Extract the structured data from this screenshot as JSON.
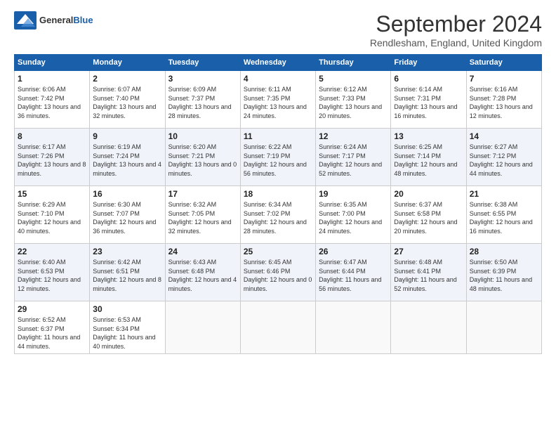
{
  "header": {
    "logo_general": "General",
    "logo_blue": "Blue",
    "title": "September 2024",
    "location": "Rendlesham, England, United Kingdom"
  },
  "weekdays": [
    "Sunday",
    "Monday",
    "Tuesday",
    "Wednesday",
    "Thursday",
    "Friday",
    "Saturday"
  ],
  "weeks": [
    [
      {
        "day": "1",
        "sunrise": "6:06 AM",
        "sunset": "7:42 PM",
        "daylight": "13 hours and 36 minutes."
      },
      {
        "day": "2",
        "sunrise": "6:07 AM",
        "sunset": "7:40 PM",
        "daylight": "13 hours and 32 minutes."
      },
      {
        "day": "3",
        "sunrise": "6:09 AM",
        "sunset": "7:37 PM",
        "daylight": "13 hours and 28 minutes."
      },
      {
        "day": "4",
        "sunrise": "6:11 AM",
        "sunset": "7:35 PM",
        "daylight": "13 hours and 24 minutes."
      },
      {
        "day": "5",
        "sunrise": "6:12 AM",
        "sunset": "7:33 PM",
        "daylight": "13 hours and 20 minutes."
      },
      {
        "day": "6",
        "sunrise": "6:14 AM",
        "sunset": "7:31 PM",
        "daylight": "13 hours and 16 minutes."
      },
      {
        "day": "7",
        "sunrise": "6:16 AM",
        "sunset": "7:28 PM",
        "daylight": "13 hours and 12 minutes."
      }
    ],
    [
      {
        "day": "8",
        "sunrise": "6:17 AM",
        "sunset": "7:26 PM",
        "daylight": "13 hours and 8 minutes."
      },
      {
        "day": "9",
        "sunrise": "6:19 AM",
        "sunset": "7:24 PM",
        "daylight": "13 hours and 4 minutes."
      },
      {
        "day": "10",
        "sunrise": "6:20 AM",
        "sunset": "7:21 PM",
        "daylight": "13 hours and 0 minutes."
      },
      {
        "day": "11",
        "sunrise": "6:22 AM",
        "sunset": "7:19 PM",
        "daylight": "12 hours and 56 minutes."
      },
      {
        "day": "12",
        "sunrise": "6:24 AM",
        "sunset": "7:17 PM",
        "daylight": "12 hours and 52 minutes."
      },
      {
        "day": "13",
        "sunrise": "6:25 AM",
        "sunset": "7:14 PM",
        "daylight": "12 hours and 48 minutes."
      },
      {
        "day": "14",
        "sunrise": "6:27 AM",
        "sunset": "7:12 PM",
        "daylight": "12 hours and 44 minutes."
      }
    ],
    [
      {
        "day": "15",
        "sunrise": "6:29 AM",
        "sunset": "7:10 PM",
        "daylight": "12 hours and 40 minutes."
      },
      {
        "day": "16",
        "sunrise": "6:30 AM",
        "sunset": "7:07 PM",
        "daylight": "12 hours and 36 minutes."
      },
      {
        "day": "17",
        "sunrise": "6:32 AM",
        "sunset": "7:05 PM",
        "daylight": "12 hours and 32 minutes."
      },
      {
        "day": "18",
        "sunrise": "6:34 AM",
        "sunset": "7:02 PM",
        "daylight": "12 hours and 28 minutes."
      },
      {
        "day": "19",
        "sunrise": "6:35 AM",
        "sunset": "7:00 PM",
        "daylight": "12 hours and 24 minutes."
      },
      {
        "day": "20",
        "sunrise": "6:37 AM",
        "sunset": "6:58 PM",
        "daylight": "12 hours and 20 minutes."
      },
      {
        "day": "21",
        "sunrise": "6:38 AM",
        "sunset": "6:55 PM",
        "daylight": "12 hours and 16 minutes."
      }
    ],
    [
      {
        "day": "22",
        "sunrise": "6:40 AM",
        "sunset": "6:53 PM",
        "daylight": "12 hours and 12 minutes."
      },
      {
        "day": "23",
        "sunrise": "6:42 AM",
        "sunset": "6:51 PM",
        "daylight": "12 hours and 8 minutes."
      },
      {
        "day": "24",
        "sunrise": "6:43 AM",
        "sunset": "6:48 PM",
        "daylight": "12 hours and 4 minutes."
      },
      {
        "day": "25",
        "sunrise": "6:45 AM",
        "sunset": "6:46 PM",
        "daylight": "12 hours and 0 minutes."
      },
      {
        "day": "26",
        "sunrise": "6:47 AM",
        "sunset": "6:44 PM",
        "daylight": "11 hours and 56 minutes."
      },
      {
        "day": "27",
        "sunrise": "6:48 AM",
        "sunset": "6:41 PM",
        "daylight": "11 hours and 52 minutes."
      },
      {
        "day": "28",
        "sunrise": "6:50 AM",
        "sunset": "6:39 PM",
        "daylight": "11 hours and 48 minutes."
      }
    ],
    [
      {
        "day": "29",
        "sunrise": "6:52 AM",
        "sunset": "6:37 PM",
        "daylight": "11 hours and 44 minutes."
      },
      {
        "day": "30",
        "sunrise": "6:53 AM",
        "sunset": "6:34 PM",
        "daylight": "11 hours and 40 minutes."
      },
      null,
      null,
      null,
      null,
      null
    ]
  ]
}
